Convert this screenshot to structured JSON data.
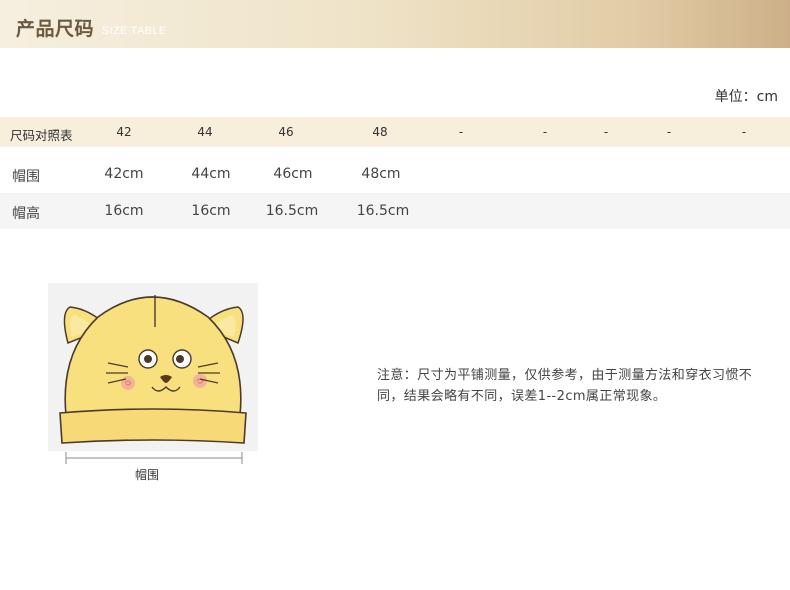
{
  "header": {
    "title": "产品尺码",
    "subtitle": "SIZE TABLE"
  },
  "unit": "单位：cm",
  "table": {
    "header": {
      "label": "尺码对照表",
      "cells": [
        "42",
        "44",
        "46",
        "48",
        "-",
        "-",
        "-",
        "-",
        "-"
      ]
    },
    "rows": [
      {
        "label": "帽围",
        "cells": [
          "42cm",
          "44cm",
          "46cm",
          "48cm"
        ]
      },
      {
        "label": "帽高",
        "cells": [
          "16cm",
          "16cm",
          "16.5cm",
          "16.5cm"
        ]
      }
    ]
  },
  "illustration": {
    "caption": "帽围",
    "hat_color": "#f9e07e",
    "outline_color": "#4a3a2a"
  },
  "note": "注意：尺寸为平铺测量，仅供参考，由于测量方法和穿衣习惯不同，结果会略有不同，误差1--2cm属正常现象。",
  "colors": {
    "header_gradient_start": "#f6efdf",
    "header_gradient_end": "#cdb089",
    "table_header_bg": "#f7efdc",
    "alt_row_bg": "#f5f5f5"
  }
}
